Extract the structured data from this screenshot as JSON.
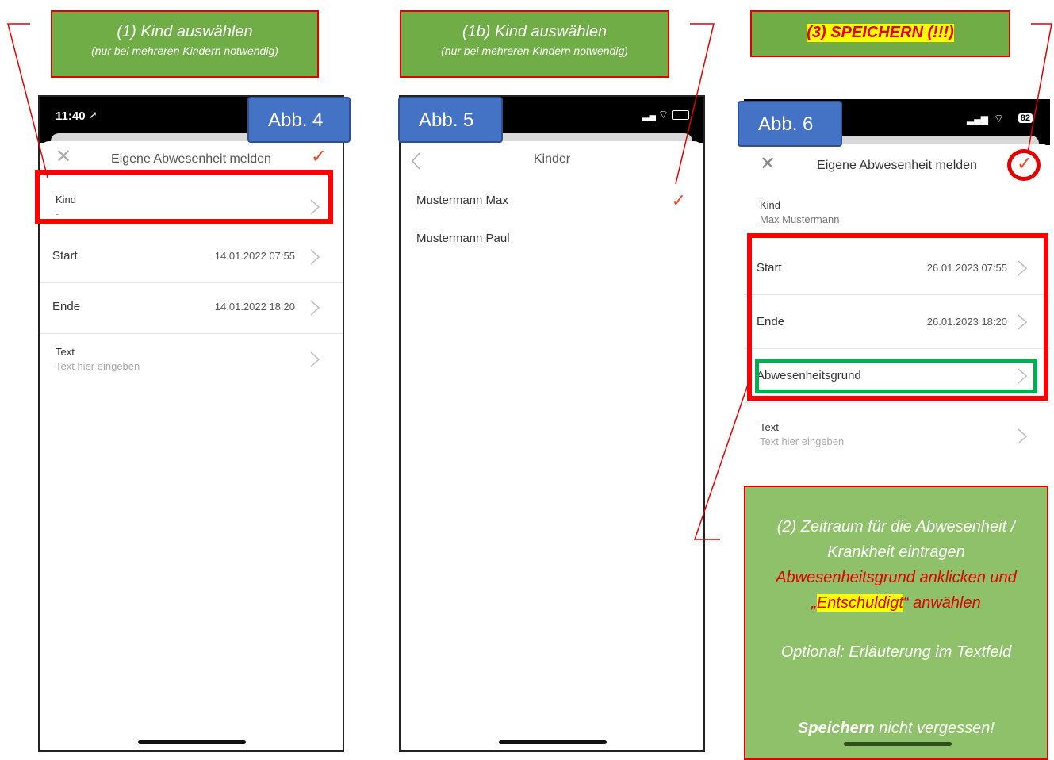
{
  "callouts": {
    "c1_line1": "(1) Kind auswählen",
    "c1_line2": "(nur bei mehreren Kindern notwendig)",
    "c1b_line1": "(1b) Kind auswählen",
    "c1b_line2": "(nur bei mehreren Kindern notwendig)",
    "c3": "(3) SPEICHERN (!!!)",
    "c2_line1": "(2) Zeitraum für die Abwesenheit /",
    "c2_line2": "Krankheit eintragen",
    "c2_line3": "Abwesenheitsgrund anklicken und",
    "c2_line4a": "„",
    "c2_line4b": "Entschuldigt",
    "c2_line4c": "“ anwählen",
    "c2_line5": "Optional: Erläuterung im Textfeld",
    "c2_line6a": "Speichern",
    "c2_line6b": " nicht vergessen!"
  },
  "labels": {
    "abb4": "Abb. 4",
    "abb5": "Abb. 5",
    "abb6": "Abb. 6"
  },
  "phone1": {
    "time": "11:40",
    "title": "Eigene Abwesenheit melden",
    "kind_label": "Kind",
    "kind_value": "-",
    "start_label": "Start",
    "start_value": "14.01.2022 07:55",
    "ende_label": "Ende",
    "ende_value": "14.01.2022 18:20",
    "text_label": "Text",
    "text_placeholder": "Text hier eingeben"
  },
  "phone2": {
    "title": "Kinder",
    "children": [
      "Mustermann Max",
      "Mustermann Paul"
    ]
  },
  "phone3": {
    "battery": "82",
    "title": "Eigene Abwesenheit melden",
    "kind_label": "Kind",
    "kind_value": "Max Mustermann",
    "start_label": "Start",
    "start_value": "26.01.2023 07:55",
    "ende_label": "Ende",
    "ende_value": "26.01.2023 18:20",
    "grund_label": "Abwesenheitsgrund",
    "text_label": "Text",
    "text_placeholder": "Text hier eingeben"
  },
  "colors": {
    "accent": "#e8492c",
    "callout_green": "#70ad47",
    "highlight_red": "#ff0000",
    "highlight_green": "#00b050",
    "label_blue": "#4472c4"
  }
}
